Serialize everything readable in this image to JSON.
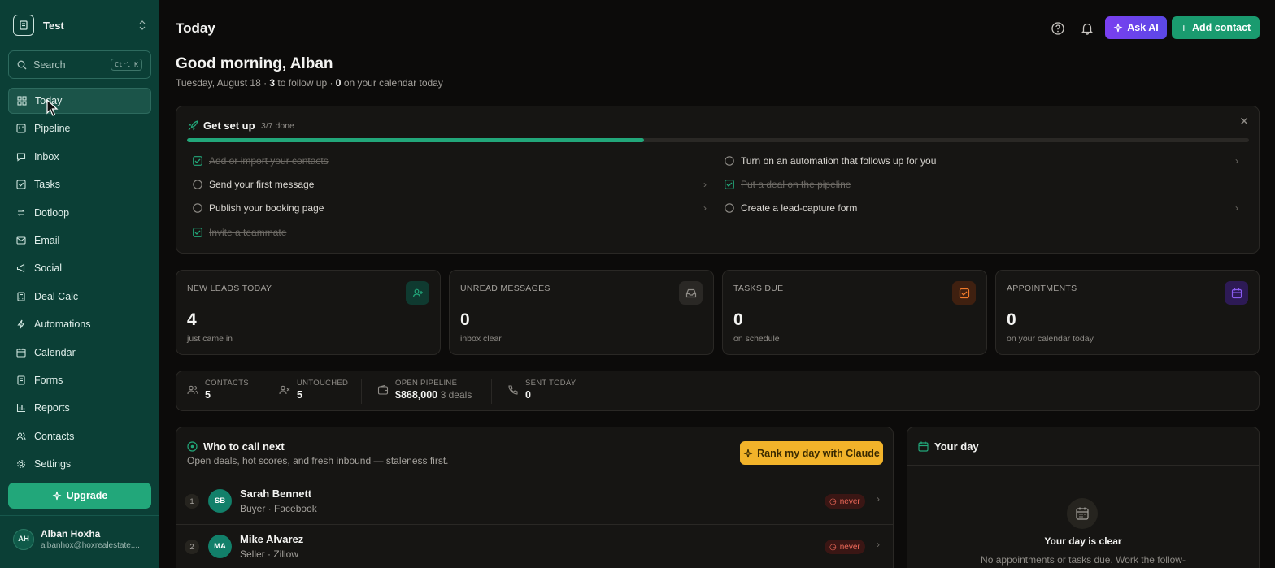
{
  "workspace": {
    "name": "Test"
  },
  "search": {
    "label": "Search",
    "shortcut": "Ctrl K"
  },
  "sidebar": {
    "items": [
      {
        "label": "Today",
        "icon": "grid-icon",
        "active": true
      },
      {
        "label": "Pipeline",
        "icon": "kanban-icon"
      },
      {
        "label": "Inbox",
        "icon": "chat-icon"
      },
      {
        "label": "Tasks",
        "icon": "check-square-icon"
      },
      {
        "label": "Dotloop",
        "icon": "loop-icon"
      },
      {
        "label": "Email",
        "icon": "mail-icon"
      },
      {
        "label": "Social",
        "icon": "megaphone-icon"
      },
      {
        "label": "Deal Calc",
        "icon": "calculator-icon"
      },
      {
        "label": "Automations",
        "icon": "bolt-icon"
      },
      {
        "label": "Calendar",
        "icon": "calendar-icon"
      },
      {
        "label": "Forms",
        "icon": "form-icon"
      },
      {
        "label": "Reports",
        "icon": "bar-chart-icon"
      },
      {
        "label": "Contacts",
        "icon": "users-icon"
      },
      {
        "label": "Settings",
        "icon": "gear-icon"
      }
    ],
    "upgrade_label": "Upgrade"
  },
  "user": {
    "initials": "AH",
    "name": "Alban Hoxha",
    "email": "albanhox@hoxrealestate...."
  },
  "header": {
    "title": "Today",
    "ask_ai": "Ask AI",
    "add_contact": "Add contact"
  },
  "greeting": {
    "title": "Good morning, Alban",
    "date": "Tuesday, August 18 · ",
    "follow_count": "3",
    "follow_text": " to follow up · ",
    "calendar_count": "0",
    "calendar_text": " on your calendar today"
  },
  "setup": {
    "title": "Get set up",
    "count": "3/7 done",
    "progress": 0.43,
    "tasks": [
      {
        "label": "Add or import your contacts",
        "done": true
      },
      {
        "label": "Send your first message",
        "done": false
      },
      {
        "label": "Publish your booking page",
        "done": false
      },
      {
        "label": "Invite a teammate",
        "done": true
      },
      {
        "label": "Turn on an automation that follows up for you",
        "done": false
      },
      {
        "label": "Put a deal on the pipeline",
        "done": true
      },
      {
        "label": "Create a lead-capture form",
        "done": false
      }
    ]
  },
  "stats": [
    {
      "label": "NEW LEADS TODAY",
      "value": "4",
      "sub": "just came in",
      "icon": "user-plus-icon",
      "color": "#22a77a"
    },
    {
      "label": "UNREAD MESSAGES",
      "value": "0",
      "sub": "inbox clear",
      "icon": "inbox-icon",
      "color": "#8f8c87"
    },
    {
      "label": "TASKS DUE",
      "value": "0",
      "sub": "on schedule",
      "icon": "check-square-icon",
      "color": "#f07a2a"
    },
    {
      "label": "APPOINTMENTS",
      "value": "0",
      "sub": "on your calendar today",
      "icon": "calendar-icon",
      "color": "#8a5cf0"
    }
  ],
  "kpis": [
    {
      "label": "CONTACTS",
      "value": "5",
      "icon": "users-icon"
    },
    {
      "label": "UNTOUCHED",
      "value": "5",
      "icon": "user-x-icon"
    },
    {
      "label": "OPEN PIPELINE",
      "value": "$868,000",
      "extra": "3 deals",
      "icon": "wallet-icon"
    },
    {
      "label": "SENT TODAY",
      "value": "0",
      "icon": "phone-icon"
    }
  ],
  "call_next": {
    "title": "Who to call next",
    "subtitle": "Open deals, hot scores, and fresh inbound — staleness first.",
    "rank_button": "Rank my day with Claude",
    "rows": [
      {
        "num": "1",
        "initials": "SB",
        "name": "Sarah Bennett",
        "meta": "Buyer · Facebook",
        "badge": "never"
      },
      {
        "num": "2",
        "initials": "MA",
        "name": "Mike Alvarez",
        "meta": "Seller · Zillow",
        "badge": "never"
      }
    ]
  },
  "your_day": {
    "title": "Your day",
    "empty_title": "Your day is clear",
    "empty_sub": "No appointments or tasks due. Work the follow-"
  }
}
